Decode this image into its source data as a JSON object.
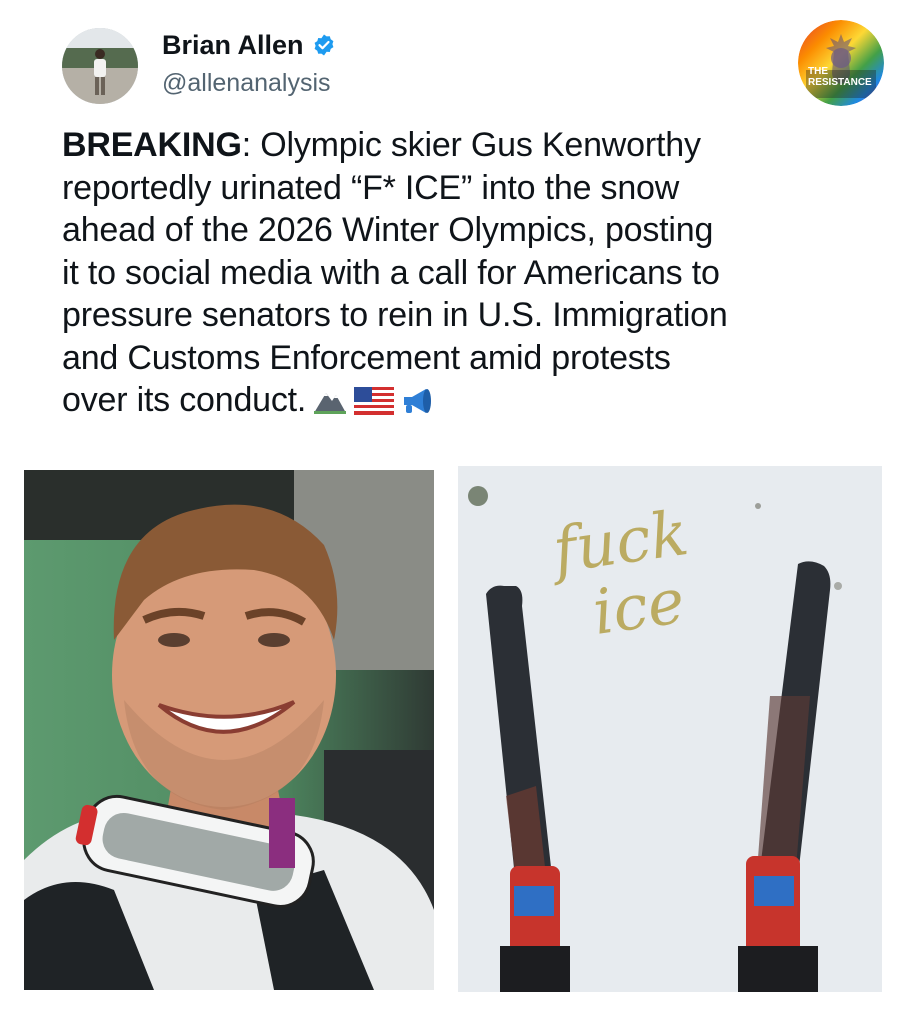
{
  "author": {
    "name": "Brian Allen",
    "handle": "@allenanalysis",
    "verified": true
  },
  "badge": {
    "line1": "THE",
    "line2": "RESISTANCE"
  },
  "tweet": {
    "lead": "BREAKING",
    "body_lines": [
      ": Olympic skier Gus Kenworthy",
      "reportedly urinated “F* ICE” into the snow",
      "ahead of the 2026 Winter Olympics, posting",
      "it to social media with a call for Americans to",
      "pressure senators to rein in U.S. Immigration",
      "and Customs Enforcement amid protests",
      "over its conduct."
    ],
    "emojis": [
      "mountain-icon",
      "us-flag-icon",
      "megaphone-icon"
    ]
  },
  "media": {
    "right_snow_text_line1": "fuck",
    "right_snow_text_line2": "ice"
  },
  "colors": {
    "text": "#0f1419",
    "secondary": "#536471",
    "verified": "#1d9bf0"
  }
}
